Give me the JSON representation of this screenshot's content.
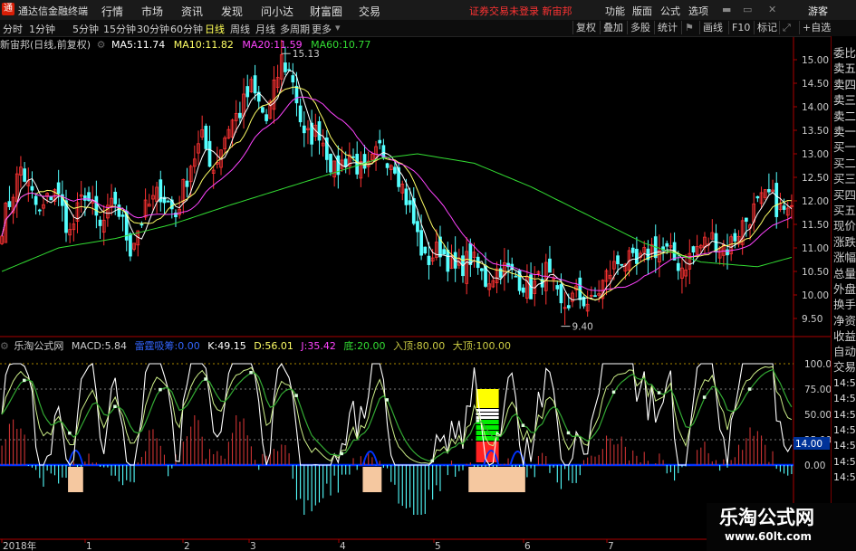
{
  "app": {
    "logo_glyph": "通",
    "title": "通达信金融终端",
    "menu": [
      "行情",
      "市场",
      "资讯",
      "发现",
      "问小达",
      "财富圈",
      "交易"
    ],
    "notice": "证券交易未登录 新宙邦",
    "right_menu": [
      "功能",
      "版面",
      "公式",
      "选项",
      "游客"
    ]
  },
  "toolbar": {
    "periods": [
      "分时",
      "1分钟",
      "5分钟",
      "15分钟",
      "30分钟",
      "60分钟",
      "日线",
      "周线",
      "月线",
      "多周期",
      "更多"
    ],
    "active_period": "日线",
    "right_buttons": [
      "复权",
      "叠加",
      "多股",
      "统计",
      "画线",
      "F10",
      "标记",
      "+自选"
    ]
  },
  "main_legend": {
    "title": "新宙邦(日线,前复权)",
    "items": [
      {
        "label": "MA5:",
        "value": "11.74",
        "color": "#ffffff"
      },
      {
        "label": "MA10:",
        "value": "11.82",
        "color": "#ffff66"
      },
      {
        "label": "MA20:",
        "value": "11.59",
        "color": "#ff44ff"
      },
      {
        "label": "MA60:",
        "value": "10.77",
        "color": "#33dd33"
      }
    ]
  },
  "indicator_legend": {
    "title": "乐淘公式网",
    "items": [
      {
        "label": "MACD:",
        "value": "5.84",
        "color": "#cccccc"
      },
      {
        "label": "雷霆吸筹:",
        "value": "0.00",
        "color": "#3366ff"
      },
      {
        "label": "K:",
        "value": "49.15",
        "color": "#ffffff"
      },
      {
        "label": "D:",
        "value": "56.01",
        "color": "#ffff66"
      },
      {
        "label": "J:",
        "value": "35.42",
        "color": "#ff44ff"
      },
      {
        "label": "底:",
        "value": "20.00",
        "color": "#33dd33"
      },
      {
        "label": "入顶:",
        "value": "80.00",
        "color": "#cccc44"
      },
      {
        "label": "大顶:",
        "value": "100.00",
        "color": "#cccc44"
      }
    ]
  },
  "colors": {
    "up": "#ff3333",
    "down": "#54ffff",
    "ma5": "#ffffff",
    "ma10": "#ffff66",
    "ma20": "#ff44ff",
    "ma60": "#33dd33",
    "axis": "#aa0000",
    "blue": "#0033ff"
  },
  "chart_data": {
    "type": "candlestick",
    "price_axis": {
      "min": 9.5,
      "max": 15.0,
      "ticks": [
        "15.00",
        "14.50",
        "14.00",
        "13.50",
        "13.00",
        "12.50",
        "12.00",
        "11.50",
        "11.00",
        "10.50",
        "10.00",
        "9.50"
      ]
    },
    "high_mark": "15.13",
    "low_mark": "9.40",
    "x_labels": [
      "2018年",
      "1",
      "2",
      "3",
      "4",
      "5",
      "6",
      "7"
    ],
    "indicator_axis": {
      "ticks": [
        "100.00",
        "75.00",
        "50.00",
        "25.00",
        "0.00"
      ],
      "current": "14.00"
    },
    "anchors": [
      [
        0,
        11.5
      ],
      [
        5,
        12.7
      ],
      [
        10,
        11.7
      ],
      [
        14,
        12.3
      ],
      [
        18,
        11.3
      ],
      [
        22,
        12.2
      ],
      [
        26,
        11.4
      ],
      [
        30,
        12.0
      ],
      [
        34,
        11.0
      ],
      [
        38,
        11.8
      ],
      [
        42,
        12.2
      ],
      [
        46,
        11.7
      ],
      [
        50,
        12.8
      ],
      [
        53,
        13.3
      ],
      [
        56,
        12.7
      ],
      [
        60,
        13.6
      ],
      [
        63,
        13.9
      ],
      [
        66,
        14.4
      ],
      [
        70,
        13.7
      ],
      [
        74,
        15.0
      ],
      [
        77,
        14.6
      ],
      [
        80,
        13.3
      ],
      [
        84,
        13.5
      ],
      [
        88,
        12.6
      ],
      [
        92,
        13.0
      ],
      [
        96,
        12.5
      ],
      [
        100,
        13.1
      ],
      [
        104,
        12.8
      ],
      [
        108,
        11.8
      ],
      [
        112,
        10.7
      ],
      [
        116,
        11.0
      ],
      [
        120,
        10.5
      ],
      [
        124,
        10.8
      ],
      [
        128,
        10.3
      ],
      [
        132,
        10.6
      ],
      [
        136,
        10.4
      ],
      [
        140,
        10.1
      ],
      [
        144,
        10.5
      ],
      [
        148,
        9.7
      ],
      [
        152,
        10.0
      ],
      [
        156,
        9.8
      ],
      [
        160,
        10.4
      ],
      [
        164,
        10.8
      ],
      [
        168,
        10.6
      ],
      [
        172,
        11.0
      ],
      [
        176,
        10.9
      ],
      [
        180,
        10.6
      ],
      [
        184,
        11.0
      ],
      [
        188,
        11.2
      ],
      [
        192,
        11.0
      ],
      [
        196,
        11.5
      ],
      [
        200,
        11.9
      ],
      [
        203,
        12.1
      ],
      [
        206,
        11.8
      ],
      [
        209,
        11.7
      ]
    ],
    "ma60_anchors": [
      [
        0,
        10.5
      ],
      [
        15,
        11.0
      ],
      [
        30,
        11.2
      ],
      [
        45,
        11.5
      ],
      [
        60,
        11.9
      ],
      [
        80,
        12.4
      ],
      [
        100,
        12.9
      ],
      [
        110,
        13.0
      ],
      [
        125,
        12.8
      ],
      [
        140,
        12.3
      ],
      [
        155,
        11.7
      ],
      [
        170,
        11.1
      ],
      [
        185,
        10.7
      ],
      [
        200,
        10.6
      ],
      [
        209,
        10.8
      ]
    ]
  },
  "side_panel": [
    "委比",
    "卖五",
    "卖四",
    "卖三",
    "卖二",
    "卖一",
    "买一",
    "买二",
    "买三",
    "买四",
    "买五",
    "现价",
    "涨跌",
    "涨幅",
    "总量",
    "外盘",
    "换手",
    "净资",
    "收益"
  ],
  "side_panel2": [
    "自动",
    "交易",
    "14:56",
    "14:56",
    "14:56",
    "14:56",
    "14:56",
    "14:56",
    "14:56"
  ],
  "watermark": {
    "line1": "乐淘公式网",
    "line2": "www.60lt.com"
  }
}
